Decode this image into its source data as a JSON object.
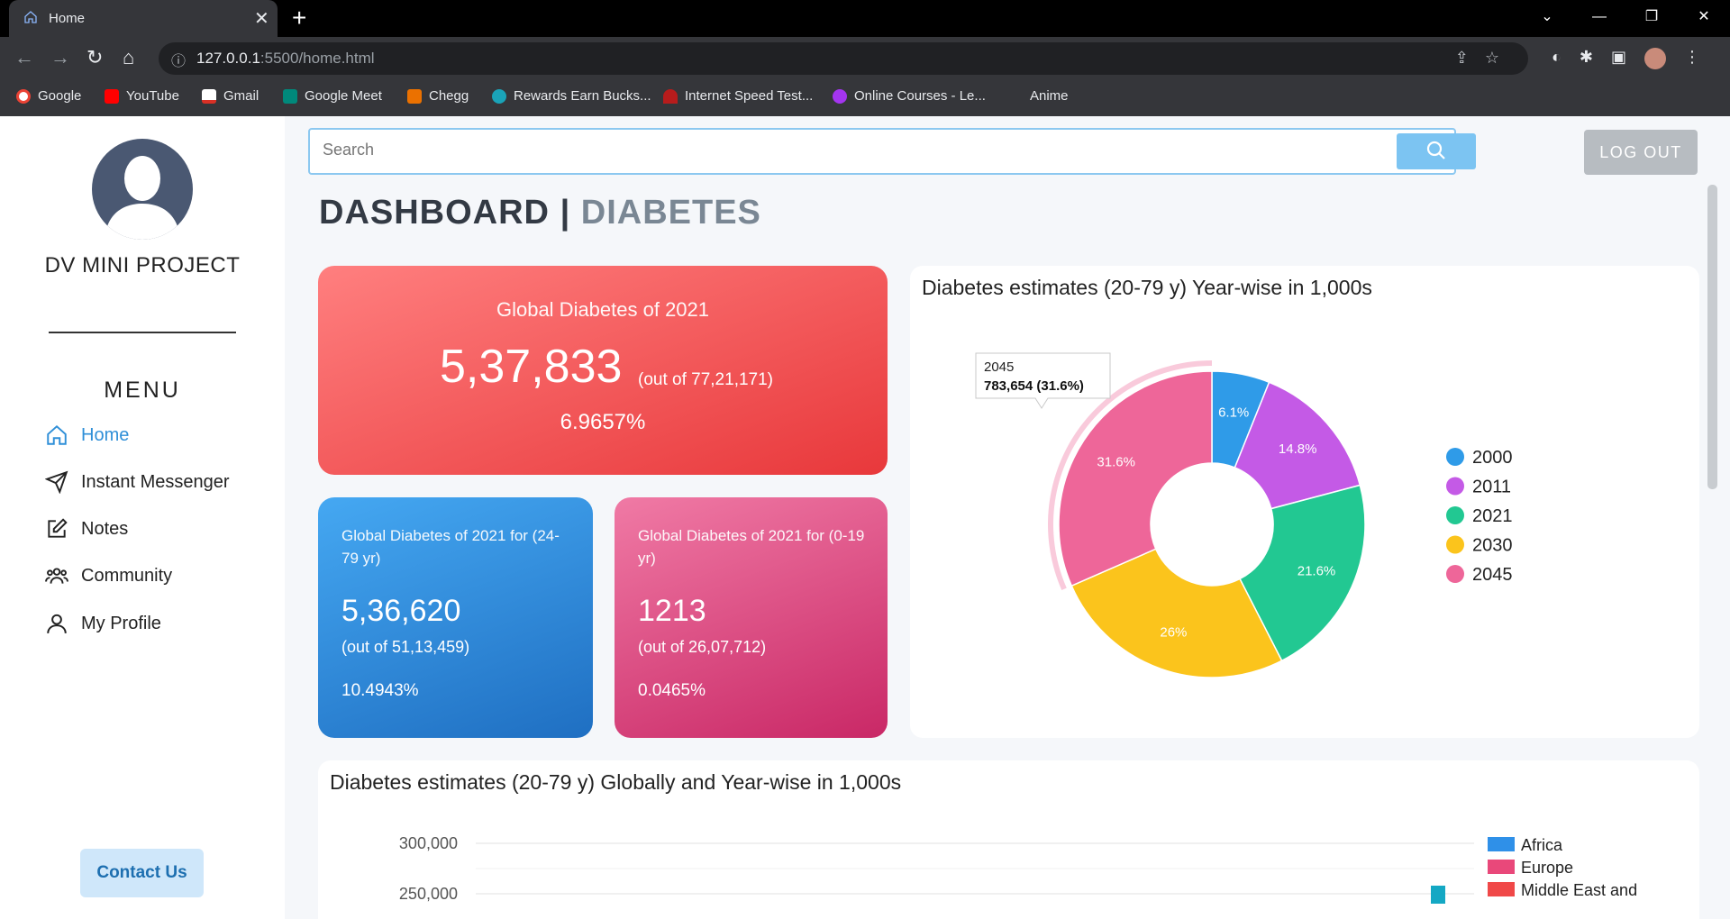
{
  "browser": {
    "tab_title": "Home",
    "url_host": "127.0.0.1",
    "url_path": ":5500/home.html",
    "bookmarks": [
      {
        "label": "Google",
        "color": "#ea4335"
      },
      {
        "label": "YouTube",
        "color": "#ff0000"
      },
      {
        "label": "Gmail",
        "color": "#d93025"
      },
      {
        "label": "Google Meet",
        "color": "#00897b"
      },
      {
        "label": "Chegg",
        "color": "#eb7100"
      },
      {
        "label": "Rewards Earn Bucks...",
        "color": "#1aa3b8"
      },
      {
        "label": "Internet Speed Test...",
        "color": "#b71c1c"
      },
      {
        "label": "Online Courses - Le...",
        "color": "#a435f0"
      },
      {
        "label": "Anime",
        "color": ""
      }
    ]
  },
  "sidebar": {
    "project_title": "DV MINI PROJECT",
    "menu_title": "MENU",
    "items": [
      {
        "label": "Home",
        "icon": "home-icon"
      },
      {
        "label": "Instant Messenger",
        "icon": "send-icon"
      },
      {
        "label": "Notes",
        "icon": "edit-icon"
      },
      {
        "label": "Community",
        "icon": "users-icon"
      },
      {
        "label": "My Profile",
        "icon": "user-icon"
      }
    ],
    "contact_label": "Contact Us"
  },
  "header": {
    "search_placeholder": "Search",
    "logout_label": "LOG OUT"
  },
  "page": {
    "title_main": "DASHBOARD",
    "title_sep": "|",
    "title_sub": "DIABETES"
  },
  "cards": {
    "total": {
      "title": "Global Diabetes of 2021",
      "value": "5,37,833",
      "of": "(out of 77,21,171)",
      "percent": "6.9657%"
    },
    "adult": {
      "title": "Global Diabetes of 2021 for (24-79 yr)",
      "value": "5,36,620",
      "of": "(out of 51,13,459)",
      "percent": "10.4943%"
    },
    "child": {
      "title": "Global Diabetes of 2021 for (0-19 yr)",
      "value": "1213",
      "of": "(out of 26,07,712)",
      "percent": "0.0465%"
    }
  },
  "chart_data": [
    {
      "type": "pie",
      "title": "Diabetes estimates (20-79 y) Year-wise in 1,000s",
      "categories": [
        "2000",
        "2011",
        "2021",
        "2030",
        "2045"
      ],
      "percent_labels": [
        "6.1%",
        "14.8%",
        "21.6%",
        "26%",
        "31.6%"
      ],
      "values": [
        6.1,
        14.8,
        21.6,
        26,
        31.6
      ],
      "colors": [
        "#2f9be8",
        "#c45ae6",
        "#22c892",
        "#fbc41c",
        "#ee6699"
      ],
      "legend_position": "right",
      "tooltip": {
        "category": "2045",
        "value": "783,654 (31.6%)"
      }
    },
    {
      "type": "bar",
      "title": "Diabetes estimates (20-79 y) Globally and Year-wise in 1,000s",
      "y_ticks": [
        "300,000",
        "250,000"
      ],
      "legend": [
        "Africa",
        "Europe",
        "Middle East and"
      ],
      "legend_colors": [
        "#2f90e8",
        "#e9487a",
        "#f04848"
      ],
      "legend_position": "right"
    }
  ]
}
